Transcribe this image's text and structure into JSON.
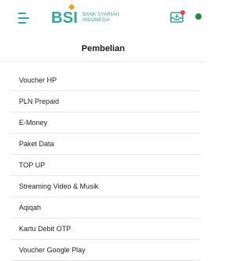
{
  "header": {
    "logo_mark": "BSI",
    "logo_line1": "BANK SYARIAH",
    "logo_line2": "INDONESIA"
  },
  "colors": {
    "brand": "#2aa89a",
    "accent": "#f2a01c",
    "status_dot": "#1f8e3b"
  },
  "page": {
    "title": "Pembelian"
  },
  "menu_items": [
    {
      "label": "Voucher HP"
    },
    {
      "label": "PLN Prepaid"
    },
    {
      "label": "E-Money"
    },
    {
      "label": "Paket Data"
    },
    {
      "label": "TOP UP"
    },
    {
      "label": "Streaming Video & Musik"
    },
    {
      "label": "Aqiqah"
    },
    {
      "label": "Kartu Debit OTP"
    },
    {
      "label": "Voucher Google Play"
    }
  ]
}
